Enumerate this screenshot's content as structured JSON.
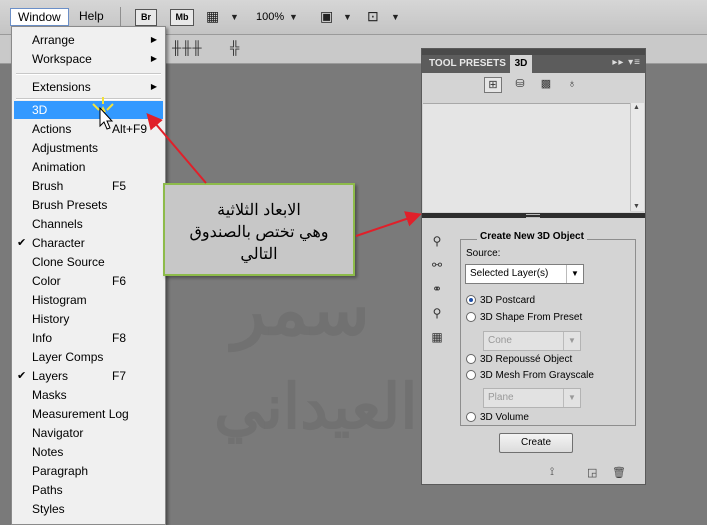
{
  "menubar": {
    "window_label": "Window",
    "help_label": "Help",
    "br_label": "Br",
    "mb_label": "Mb",
    "zoom_label": "100%"
  },
  "window_menu": {
    "items": [
      {
        "label": "Arrange",
        "shortcut": "",
        "submenu": true,
        "checked": false
      },
      {
        "label": "Workspace",
        "shortcut": "",
        "submenu": true,
        "checked": false
      },
      {
        "label": "Extensions",
        "shortcut": "",
        "submenu": true,
        "checked": false
      },
      {
        "label": "3D",
        "shortcut": "",
        "submenu": false,
        "checked": false
      },
      {
        "label": "Actions",
        "shortcut": "Alt+F9",
        "submenu": false,
        "checked": false
      },
      {
        "label": "Adjustments",
        "shortcut": "",
        "submenu": false,
        "checked": false
      },
      {
        "label": "Animation",
        "shortcut": "",
        "submenu": false,
        "checked": false
      },
      {
        "label": "Brush",
        "shortcut": "F5",
        "submenu": false,
        "checked": false
      },
      {
        "label": "Brush Presets",
        "shortcut": "",
        "submenu": false,
        "checked": false
      },
      {
        "label": "Channels",
        "shortcut": "",
        "submenu": false,
        "checked": false
      },
      {
        "label": "Character",
        "shortcut": "",
        "submenu": false,
        "checked": true
      },
      {
        "label": "Clone Source",
        "shortcut": "",
        "submenu": false,
        "checked": false
      },
      {
        "label": "Color",
        "shortcut": "F6",
        "submenu": false,
        "checked": false
      },
      {
        "label": "Histogram",
        "shortcut": "",
        "submenu": false,
        "checked": false
      },
      {
        "label": "History",
        "shortcut": "",
        "submenu": false,
        "checked": false
      },
      {
        "label": "Info",
        "shortcut": "F8",
        "submenu": false,
        "checked": false
      },
      {
        "label": "Layer Comps",
        "shortcut": "",
        "submenu": false,
        "checked": false
      },
      {
        "label": "Layers",
        "shortcut": "F7",
        "submenu": false,
        "checked": true
      },
      {
        "label": "Masks",
        "shortcut": "",
        "submenu": false,
        "checked": false
      },
      {
        "label": "Measurement Log",
        "shortcut": "",
        "submenu": false,
        "checked": false
      },
      {
        "label": "Navigator",
        "shortcut": "",
        "submenu": false,
        "checked": false
      },
      {
        "label": "Notes",
        "shortcut": "",
        "submenu": false,
        "checked": false
      },
      {
        "label": "Paragraph",
        "shortcut": "",
        "submenu": false,
        "checked": false
      },
      {
        "label": "Paths",
        "shortcut": "",
        "submenu": false,
        "checked": false
      },
      {
        "label": "Styles",
        "shortcut": "",
        "submenu": false,
        "checked": false
      }
    ],
    "highlighted": "3D"
  },
  "callout": {
    "line1": "الابعاد الثلاثية",
    "line2": "وهي تختص بالصندوق",
    "line3": "التالي",
    "border_color": "#8dbb4a"
  },
  "watermark": {
    "line1": "سمر",
    "line2": "العيداني"
  },
  "panel": {
    "tab_tool_presets": "TOOL PRESETS",
    "tab_3d": "3D",
    "group_title": "Create New 3D Object",
    "source_label": "Source:",
    "source_value": "Selected Layer(s)",
    "options": [
      {
        "label": "3D Postcard",
        "selected": true
      },
      {
        "label": "3D Shape From Preset",
        "selected": false
      },
      {
        "label": "3D Repoussé Object",
        "selected": false
      },
      {
        "label": "3D Mesh From Grayscale",
        "selected": false
      },
      {
        "label": "3D Volume",
        "selected": false
      }
    ],
    "shape_preset_value": "Cone",
    "mesh_preset_value": "Plane",
    "create_label": "Create"
  },
  "colors": {
    "highlight": "#3399ff",
    "arrow": "#e0202a",
    "canvas": "#7a7a7a"
  }
}
